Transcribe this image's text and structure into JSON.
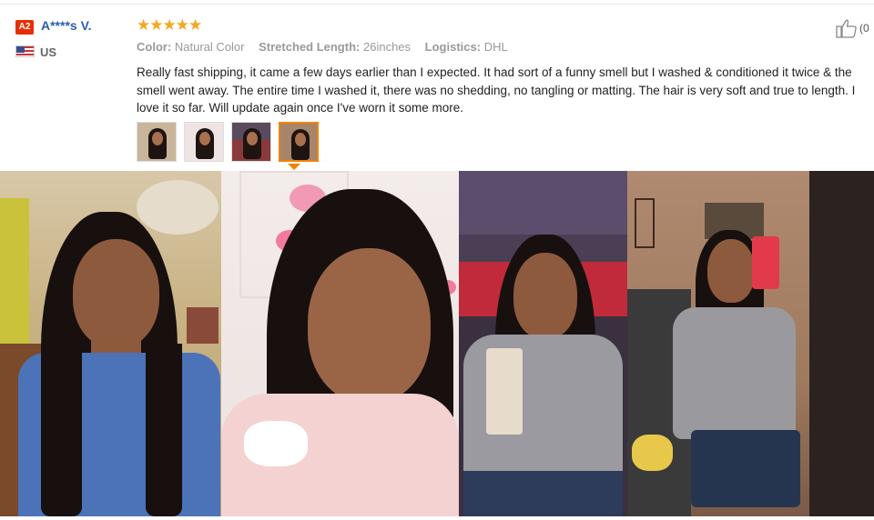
{
  "reviewer": {
    "level_badge": "A2",
    "name": "A****s V.",
    "country": "US"
  },
  "review": {
    "rating": 5,
    "stars": "★★★★★",
    "attributes": [
      {
        "key": "Color:",
        "value": "Natural Color"
      },
      {
        "key": "Stretched Length:",
        "value": "26inches"
      },
      {
        "key": "Logistics:",
        "value": "DHL"
      }
    ],
    "text": "Really fast shipping, it came a few days earlier than I expected. It had sort of a funny smell but I washed & conditioned it twice & the smell went away. The entire time I washed it, there was no shedding, no tangling or matting. The hair is very soft and true to length. I love it so far. Will update again once I've worn it some more.",
    "helpful_count": "(0"
  },
  "thumbnails": {
    "count": 4,
    "selected_index": 3
  },
  "colors": {
    "star": "#f5a623",
    "name_link": "#2a5db0",
    "badge": "#e62e04",
    "selected_border": "#f08300"
  },
  "icons": {
    "helpful": "thumbs-up-icon",
    "flag": "us-flag-icon"
  }
}
